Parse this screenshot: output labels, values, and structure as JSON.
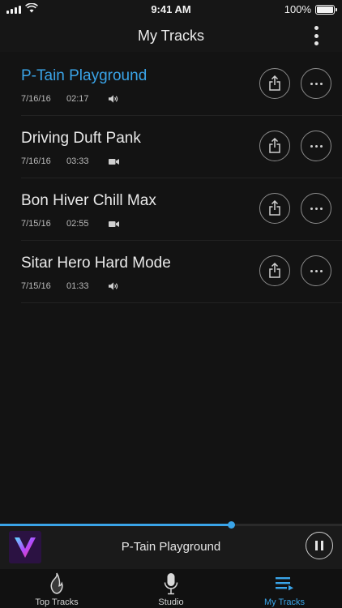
{
  "status_bar": {
    "time": "9:41 AM",
    "battery": "100%"
  },
  "nav": {
    "title": "My Tracks",
    "menu_icon": "kebab-menu-icon"
  },
  "tracks": [
    {
      "name": "P-Tain Playground",
      "date": "7/16/16",
      "duration": "02:17",
      "media_icon": "speaker-icon",
      "active": true
    },
    {
      "name": "Driving Duft Pank",
      "date": "7/16/16",
      "duration": "03:33",
      "media_icon": "video-camera-icon",
      "active": false
    },
    {
      "name": "Bon Hiver Chill Max",
      "date": "7/15/16",
      "duration": "02:55",
      "media_icon": "video-camera-icon",
      "active": false
    },
    {
      "name": "Sitar Hero Hard Mode",
      "date": "7/15/16",
      "duration": "01:33",
      "media_icon": "speaker-icon",
      "active": false
    }
  ],
  "player": {
    "title": "P-Tain Playground",
    "progress": 0.675,
    "state_icon": "pause-icon"
  },
  "tabs": [
    {
      "label": "Top Tracks",
      "icon": "flame-icon",
      "active": false
    },
    {
      "label": "Studio",
      "icon": "microphone-icon",
      "active": false
    },
    {
      "label": "My Tracks",
      "icon": "playlist-icon",
      "active": true
    }
  ],
  "colors": {
    "accent": "#3aa4e8",
    "background": "#131313"
  }
}
